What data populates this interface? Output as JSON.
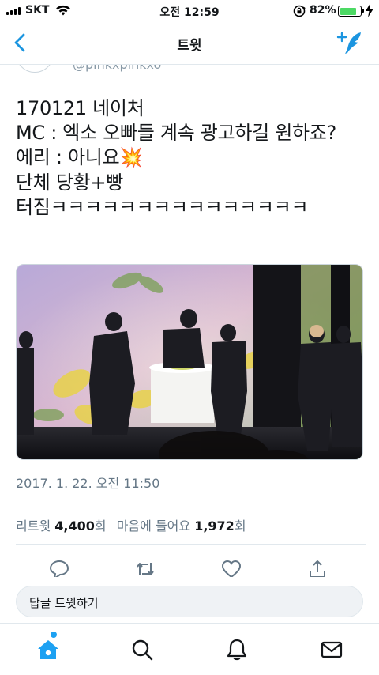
{
  "status_bar": {
    "carrier": "SKT",
    "time": "오전 12:59",
    "battery_percent": "82%",
    "battery_level": 0.82,
    "icons": [
      "signal-icon",
      "wifi-icon",
      "orientation-lock-icon",
      "battery-icon",
      "charging-bolt-icon"
    ]
  },
  "nav": {
    "title": "트윗",
    "back_icon": "chevron-left-icon",
    "compose_icon": "compose-tweet-icon"
  },
  "tweet": {
    "handle_partial": "@pinkxpinkxo",
    "text": "170121 네이처\nMC : 엑소 오빠들 계속 광고하길 원하죠?\n에리 : 아니요💥\n단체 당황+빵\n터짐ㅋㅋㅋㅋㅋㅋㅋㅋㅋㅋㅋㅋㅋㅋㅋ",
    "timestamp": "2017. 1. 22. 오전 11:50",
    "retweets_label": "리트윗",
    "retweets_count": "4,400",
    "retweets_unit": "회",
    "likes_label": "마음에 들어요",
    "likes_count": "1,972",
    "likes_unit": "회"
  },
  "actions": [
    "reply-icon",
    "retweet-icon",
    "like-icon",
    "share-icon"
  ],
  "reply": {
    "placeholder": "답글 트윗하기"
  },
  "tabs": [
    "home-icon",
    "search-icon",
    "notifications-icon",
    "messages-icon"
  ],
  "colors": {
    "accent": "#1da1f2",
    "nav_icon": "#1b95e0",
    "secondary_text": "#657786",
    "battery_fill": "#4cd964"
  }
}
